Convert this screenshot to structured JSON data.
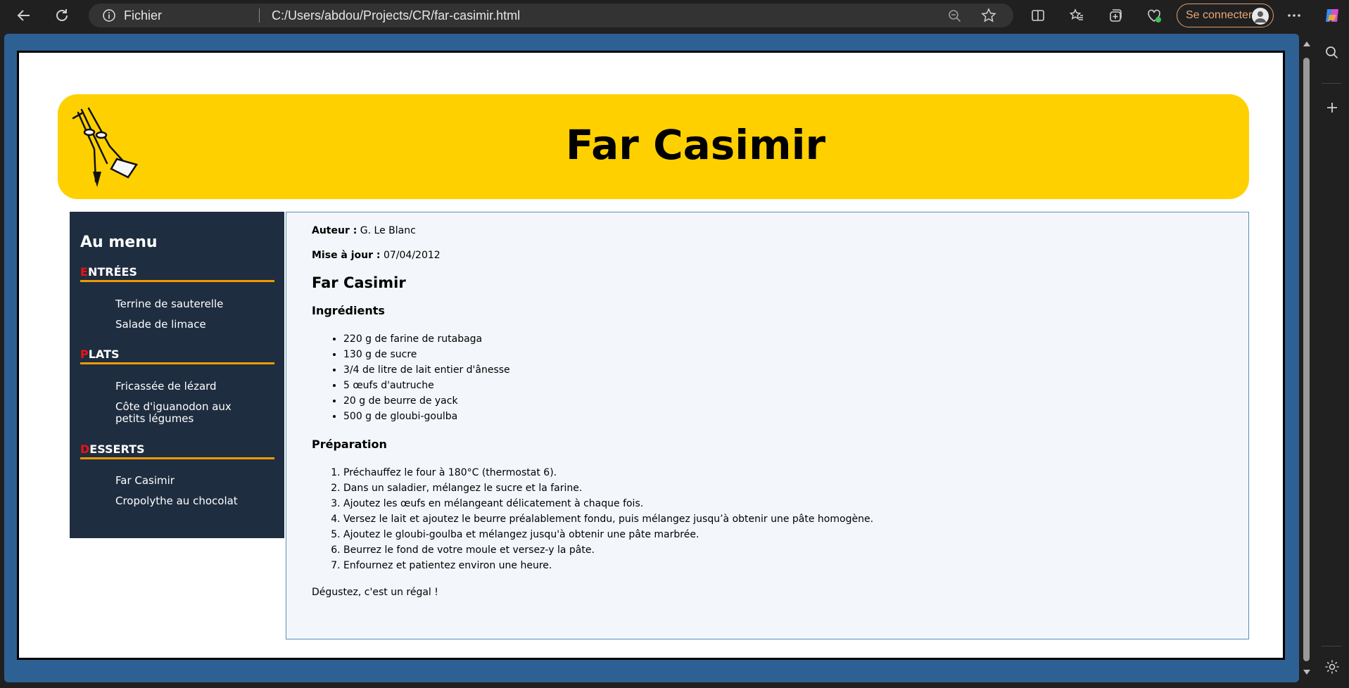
{
  "browser": {
    "scheme_label": "Fichier",
    "url": "C:/Users/abdou/Projects/CR/far-casimir.html",
    "login_label": "Se connecter"
  },
  "page": {
    "banner_title": "Far Casimir",
    "menu": {
      "title": "Au menu",
      "sections": [
        {
          "first": "E",
          "rest": "NTRÉES",
          "items": [
            "Terrine de sauterelle",
            "Salade de limace"
          ]
        },
        {
          "first": "P",
          "rest": "LATS",
          "items": [
            "Fricassée de lézard",
            "Côte d'iguanodon aux petits légumes"
          ]
        },
        {
          "first": "D",
          "rest": "ESSERTS",
          "items": [
            "Far Casimir",
            "Cropolythe au chocolat"
          ]
        }
      ]
    },
    "recipe": {
      "author_label": "Auteur :",
      "author": "G. Le Blanc",
      "updated_label": "Mise à jour :",
      "updated": "07/04/2012",
      "title": "Far Casimir",
      "ingredients_title": "Ingrédients",
      "ingredients": [
        "220 g de farine de rutabaga",
        "130 g de sucre",
        "3/4 de litre de lait entier d'ânesse",
        "5 œufs d'autruche",
        "20 g de beurre de yack",
        "500 g de gloubi-goulba"
      ],
      "preparation_title": "Préparation",
      "steps": [
        "Préchauffez le four à 180°C (thermostat 6).",
        "Dans un saladier, mélangez le sucre et la farine.",
        "Ajoutez les œufs en mélangeant délicatement à chaque fois.",
        "Versez le lait et ajoutez le beurre préalablement fondu, puis mélangez jusqu’à obtenir une pâte homogène.",
        "Ajoutez le gloubi-goulba et mélangez jusqu'à obtenir une pâte marbrée.",
        "Beurrez le fond de votre moule et versez-y la pâte.",
        "Enfournez et patientez environ une heure."
      ],
      "closing": "Dégustez, c'est un régal !"
    }
  },
  "colors": {
    "banner": "#ffd000",
    "menu_bg": "#1f2d40",
    "menu_accent": "#f09a00",
    "first_letter": "#e11111",
    "content_bg": "#f3f7fb"
  }
}
